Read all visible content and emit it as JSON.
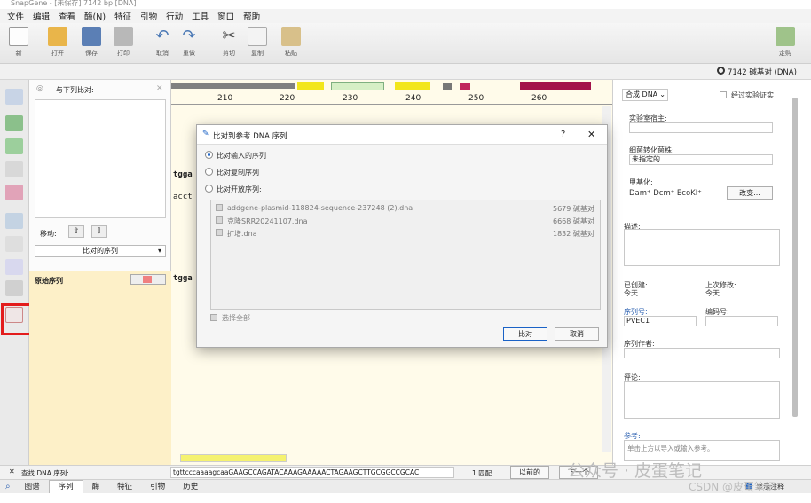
{
  "window": {
    "title": "SnapGene - [未保存] 7142 bp [DNA]"
  },
  "menu": [
    "文件",
    "编辑",
    "查看",
    "酶(N)",
    "特征",
    "引物",
    "行动",
    "工具",
    "窗口",
    "帮助"
  ],
  "toolbar": {
    "new_label": "新",
    "open_label": "打开",
    "save_label": "保存",
    "print_label": "打印",
    "undo_label": "取消",
    "redo_label": "重做",
    "cut_label": "剪切",
    "copy_label": "复制",
    "paste_label": "粘贴",
    "buy_label": "定购"
  },
  "status": {
    "bp_text": "7142 碱基对 (DNA)"
  },
  "left_panel": {
    "compare_label": "与下列比对:",
    "move_label": "移动:",
    "aligned_select": "比对的序列",
    "original_label": "原始序列"
  },
  "ruler": {
    "ticks": [
      "210",
      "220",
      "230",
      "240",
      "250",
      "260"
    ]
  },
  "sequence": {
    "line1": "tgga",
    "line2": "acct",
    "line3": "tgga"
  },
  "dialog": {
    "title": "比对到参考 DNA 序列",
    "help": "?",
    "close": "✕",
    "option1": "比对输入的序列",
    "option2": "比对复制序列",
    "option3": "比对开放序列:",
    "files": [
      {
        "name": "addgene-plasmid-118824-sequence-237248 (2).dna",
        "size": "5679 碱基对"
      },
      {
        "name": "克隆SRR20241107.dna",
        "size": "6668 碱基对"
      },
      {
        "name": "扩增.dna",
        "size": "1832 碱基对"
      }
    ],
    "select_all": "选择全部",
    "align_button": "比对",
    "cancel_button": "取消"
  },
  "right_panel": {
    "type_select": "合成 DNA",
    "verified_label": "经过实验证实",
    "lab_host_label": "实验室宿主:",
    "bact_label": "细菌转化菌株:",
    "bact_value": "未指定的",
    "methyl_label": "甲基化:",
    "methyl_value": "Dam⁺ Dcm⁺ EcoKI⁺",
    "change_button": "改变...",
    "desc_label": "描述:",
    "created_label": "已创建:",
    "created_value": "今天",
    "modified_label": "上次修改:",
    "modified_value": "今天",
    "seqnum_label": "序列号:",
    "seqnum_value": "PVEC1",
    "code_label": "编码号:",
    "author_label": "序列作者:",
    "comment_label": "评论:",
    "ref_label": "参考:",
    "ref_placeholder": "单击上方以导入或输入参考。"
  },
  "bottom": {
    "find_label": "查找 DNA 序列:",
    "find_value": "tgttcccaaaagcaaGAAGCCAGATACAAAGAAAAACTAGAAGCTTGCGGCCGCAC",
    "match_text": "1 匹配",
    "prev_button": "以前的",
    "next_button": "下一个"
  },
  "tabs": [
    "图谱",
    "序列",
    "酶",
    "特征",
    "引物",
    "历史"
  ],
  "tabs_active": "序列",
  "extra": {
    "show_label": "显示注释"
  },
  "watermark": {
    "line1": "公众号 · 皮蛋笔记",
    "line2": "CSDN @皮蛋笔记"
  },
  "colors": {
    "accent": "#1a62c6",
    "highlight": "#e31c1c",
    "seq_bg": "#fffbea"
  }
}
